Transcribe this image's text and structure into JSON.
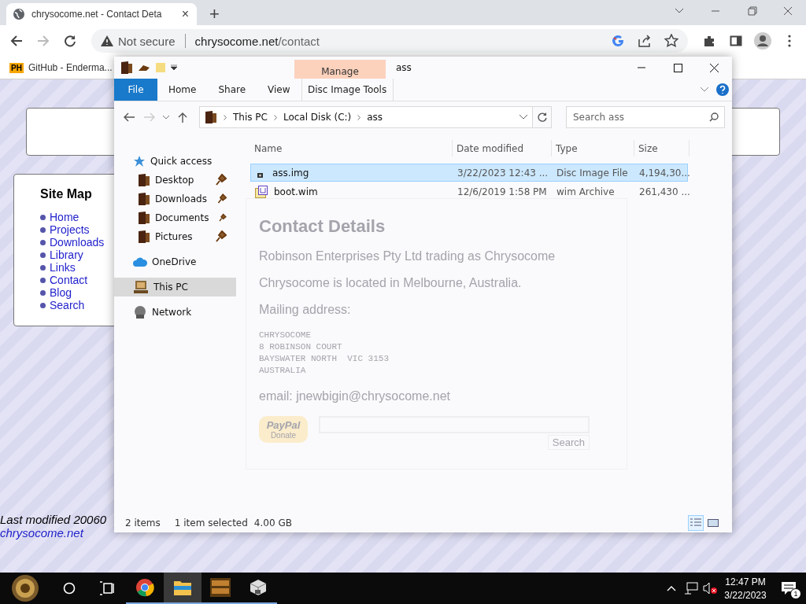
{
  "browser": {
    "tab_title": "chrysocome.net - Contact Deta",
    "tab_close": "×",
    "new_tab": "+",
    "security": "Not secure",
    "url_host": "chrysocome.net",
    "url_path": "/contact",
    "bookmarks": [
      {
        "badge": "PH",
        "label": "GitHub - Enderma..."
      }
    ]
  },
  "page": {
    "site_map": {
      "title": "Site Map",
      "links": [
        "Home",
        "Projects",
        "Downloads",
        "Library",
        "Links",
        "Contact",
        "Blog",
        "Search"
      ]
    },
    "footer": {
      "modified": "Last modified 20060",
      "link": "chrysocome.net"
    }
  },
  "ghost_page": {
    "heading": "Contact Details",
    "paragraphs": [
      "Robinson Enterprises Pty Ltd trading as Chrysocome",
      "Chrysocome is located in Melbourne, Australia.",
      "Mailing address:"
    ],
    "address": [
      "CHRYSOCOME",
      "8 ROBINSON COURT",
      "BAYSWATER NORTH  VIC 3153",
      "AUSTRALIA"
    ],
    "email": "email: jnewbigin@chrysocome.net",
    "donate": {
      "brand": "PayPal",
      "label": "Donate"
    },
    "search_button": "Search"
  },
  "explorer": {
    "title": "ass",
    "context_group": "Manage",
    "ribbon_tabs": [
      {
        "label": "File",
        "kind": "file"
      },
      {
        "label": "Home",
        "kind": "tab"
      },
      {
        "label": "Share",
        "kind": "tab"
      },
      {
        "label": "View",
        "kind": "tab"
      },
      {
        "label": "Disc Image Tools",
        "kind": "contextual"
      }
    ],
    "path": [
      "This PC",
      "Local Disk (C:)",
      "ass"
    ],
    "search_placeholder": "Search ass",
    "nav": [
      {
        "label": "Quick access",
        "kind": "star",
        "selected": false,
        "children": [
          {
            "label": "Desktop",
            "kind": "folder",
            "pinned": true,
            "selected": false
          },
          {
            "label": "Downloads",
            "kind": "folder",
            "pinned": true,
            "selected": false
          },
          {
            "label": "Documents",
            "kind": "folder",
            "pinned": true,
            "selected": false
          },
          {
            "label": "Pictures",
            "kind": "folder",
            "pinned": true,
            "selected": false
          }
        ]
      },
      {
        "label": "OneDrive",
        "kind": "cloud",
        "selected": false
      },
      {
        "label": "This PC",
        "kind": "pc",
        "selected": true
      },
      {
        "label": "Network",
        "kind": "network",
        "selected": false
      }
    ],
    "columns": [
      "Name",
      "Date modified",
      "Type",
      "Size"
    ],
    "files": [
      {
        "kind": "disc",
        "name": "ass.img",
        "modified": "3/22/2023 12:43 ...",
        "type": "Disc Image File",
        "size": "4,194,30...",
        "selected": true
      },
      {
        "kind": "archive",
        "name": "boot.wim",
        "modified": "12/6/2019 1:58 PM",
        "type": "wim Archive",
        "size": "261,430 ...",
        "selected": false
      }
    ],
    "status": {
      "count": "2 items",
      "selection": "1 item selected",
      "size": "4.00 GB"
    },
    "views": [
      {
        "kind": "details",
        "selected": true
      },
      {
        "kind": "large",
        "selected": false
      }
    ]
  },
  "taskbar": {
    "apps": [
      {
        "kind": "chrome",
        "running": true,
        "active": false
      },
      {
        "kind": "explorer",
        "running": true,
        "active": true
      },
      {
        "kind": "app",
        "running": true,
        "active": false
      },
      {
        "kind": "package",
        "running": true,
        "active": false
      }
    ],
    "time": "12:47 PM",
    "date": "3/22/2023",
    "notifications": "1"
  }
}
